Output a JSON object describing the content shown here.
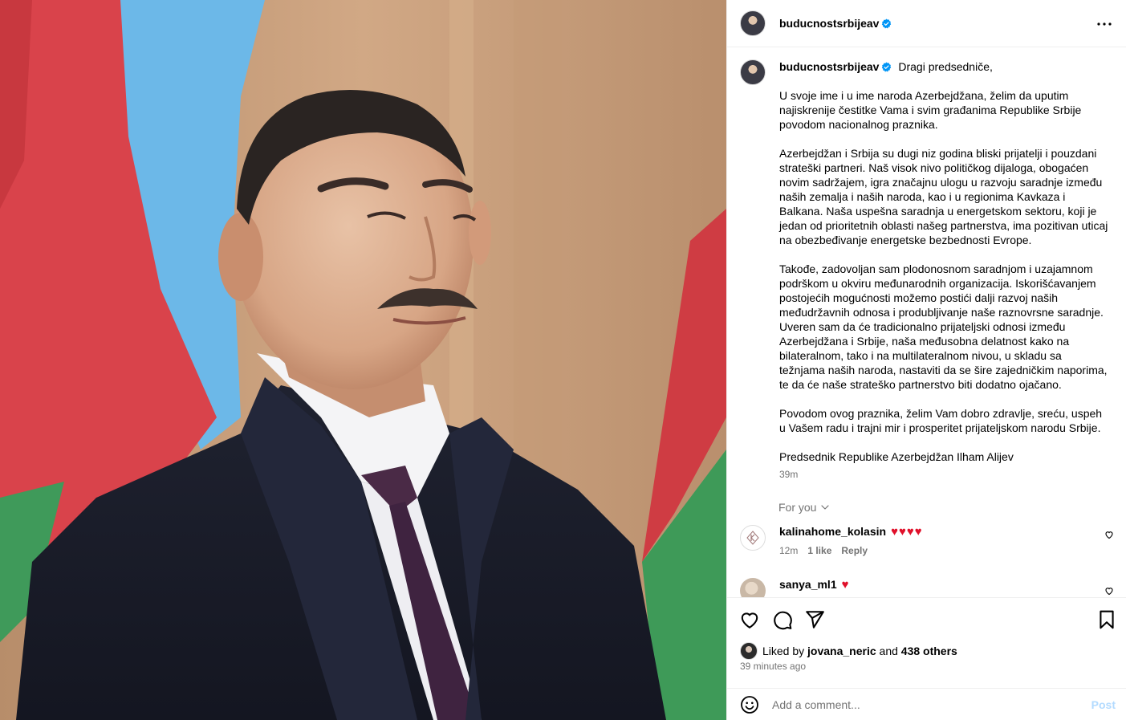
{
  "post": {
    "username": "buducnostsrbijeav",
    "verified": true
  },
  "caption": {
    "username": "buducnostsrbijeav",
    "paragraphs": [
      "Dragi predsedniče,",
      "U svoje ime i u ime naroda Azerbejdžana, želim da uputim najiskrenije čestitke Vama i svim građanima Republike Srbije povodom nacionalnog praznika.",
      "Azerbejdžan i Srbija su dugi niz godina bliski prijatelji i pouzdani strateški partneri. Naš visok nivo političkog dijaloga, obogaćen novim sadržajem, igra značajnu ulogu u razvoju saradnje između naših zemalja i naših naroda, kao i u regionima Kavkaza i Balkana. Naša uspešna saradnja u energetskom sektoru, koji je jedan od prioritetnih oblasti našeg partnerstva, ima pozitivan uticaj na obezbeđivanje energetske bezbednosti Evrope.",
      "Takođe, zadovoljan sam plodonosnom saradnjom i uzajamnom podrškom u okviru međunarodnih organizacija. Iskorišćavanjem postojećih mogućnosti možemo postići dalji razvoj naših međudržavnih odnosa i produbljivanje naše raznovrsne saradnje. Uveren sam da će tradicionalno prijateljski odnosi između Azerbejdžana i Srbije, naša međusobna delatnost kako na bilateralnom, tako i na multilateralnom nivou, u skladu sa težnjama naših naroda, nastaviti da se šire zajedničkim naporima, te da će naše strateško partnerstvo biti dodatno ojačano.",
      "Povodom ovog praznika, želim Vam dobro zdravlje, sreću, uspeh u Vašem radu i trajni mir i prosperitet prijateljskom narodu Srbije.",
      "Predsednik Republike Azerbejdžan Ilham Alijev"
    ],
    "time": "39m"
  },
  "for_you_label": "For you",
  "comments": [
    {
      "username": "kalinahome_kolasin",
      "text": "♥♥♥♥",
      "time": "12m",
      "likes": "1 like",
      "reply": "Reply"
    },
    {
      "username": "sanya_ml1",
      "text": "♥"
    }
  ],
  "likes": {
    "prefix": "Liked by",
    "user": "jovana_neric",
    "middle": "and",
    "others": "438 others"
  },
  "timestamp": "39 minutes ago",
  "add_comment": {
    "placeholder": "Add a comment...",
    "post_label": "Post"
  },
  "colors": {
    "verified": "#0095f6",
    "heart": "#e0102a",
    "post_disabled": "#b3dbff",
    "secondary_text": "#737373"
  }
}
